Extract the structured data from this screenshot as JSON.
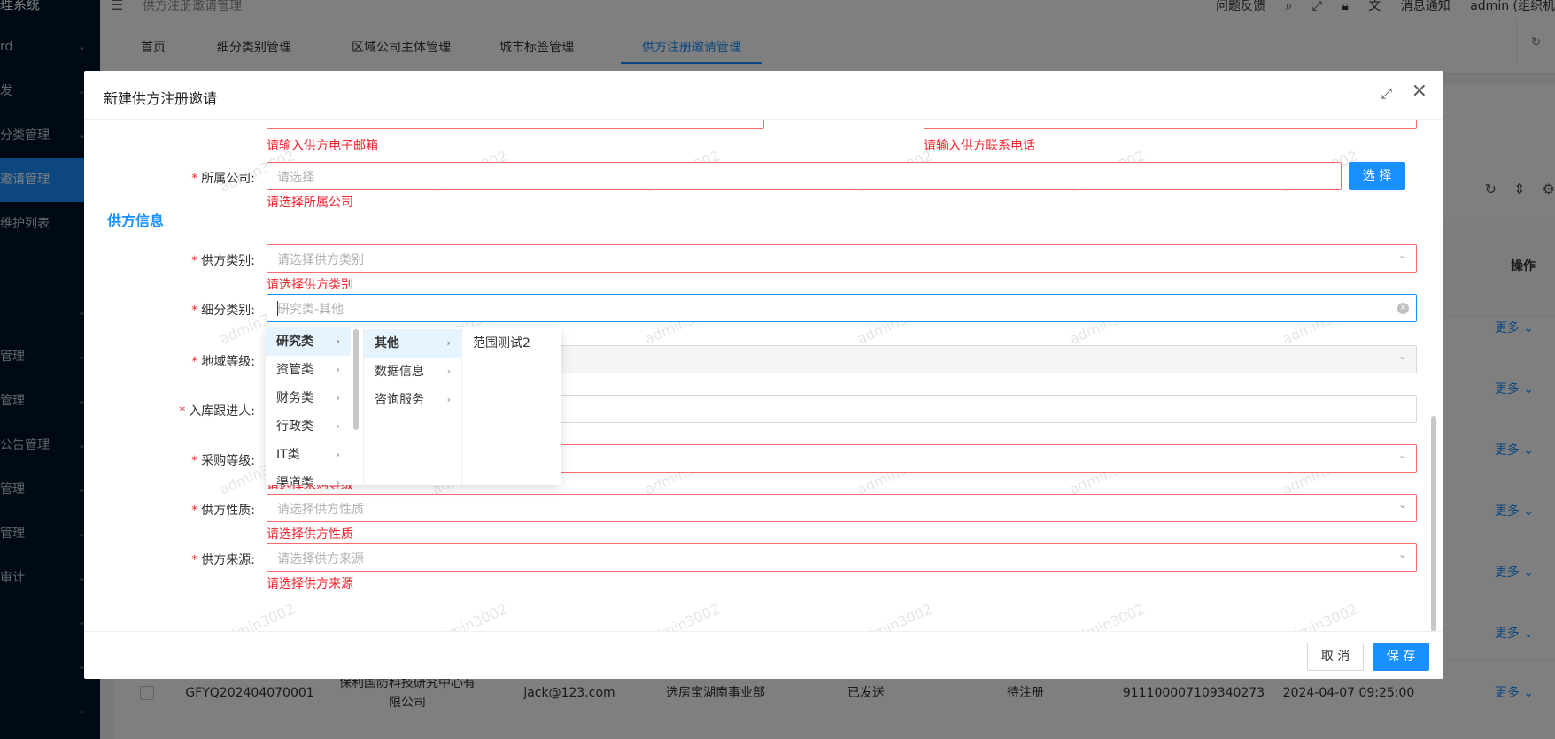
{
  "app": {
    "title": "理系统",
    "breadcrumb": "供方注册邀请管理",
    "toolbar": {
      "feedback": "问题反馈",
      "notifications": "消息通知",
      "user": "admin (组织机"
    }
  },
  "sidebar": {
    "items": [
      {
        "label": "rd"
      },
      {
        "label": "发"
      },
      {
        "label": "分类管理"
      },
      {
        "label": "邀请管理"
      },
      {
        "label": "维护列表"
      },
      {
        "label": ""
      },
      {
        "label": "管理"
      },
      {
        "label": "管理"
      },
      {
        "label": "公告管理"
      },
      {
        "label": "管理"
      },
      {
        "label": "管理"
      },
      {
        "label": "审计"
      },
      {
        "label": ""
      },
      {
        "label": ""
      },
      {
        "label": ""
      }
    ]
  },
  "tabs": [
    {
      "label": "首页"
    },
    {
      "label": "细分类别管理"
    },
    {
      "label": "区域公司主体管理"
    },
    {
      "label": "城市标签管理"
    },
    {
      "label": "供方注册邀请管理"
    }
  ],
  "table": {
    "op_header": "操作",
    "more_label": "更多",
    "row": {
      "code": "GFYQ202404070001",
      "company": "保利国防科技研究中心有限公司",
      "email": "jack@123.com",
      "dept": "选房宝湖南事业部",
      "send_status": "已发送",
      "reg_status": "待注册",
      "credit_code": "911100007109340273",
      "time": "2024-04-07 09:25:00"
    }
  },
  "dialog": {
    "title": "新建供方注册邀请",
    "watermark": "admin3002",
    "errors": {
      "email": "请输入供方电子邮箱",
      "phone": "请输入供方联系电话",
      "company": "请选择所属公司",
      "supplier_category": "请选择供方类别",
      "purchase_level_partial": "请选择采购等级",
      "nature": "请选择供方性质",
      "source": "请选择供方来源"
    },
    "fields": {
      "company": {
        "label": "所属公司:",
        "placeholder": "请选择",
        "button": "选 择"
      },
      "section_title": "供方信息",
      "supplier_category": {
        "label": "供方类别:",
        "placeholder": "请选择供方类别"
      },
      "sub_category": {
        "label": "细分类别:",
        "placeholder": "研究类-其他"
      },
      "region_level": {
        "label": "地域等级:"
      },
      "follower": {
        "label": "入库跟进人:"
      },
      "purchase_level": {
        "label": "采购等级:"
      },
      "nature": {
        "label": "供方性质:",
        "placeholder": "请选择供方性质"
      },
      "source": {
        "label": "供方来源:",
        "placeholder": "请选择供方来源"
      }
    },
    "cascader": {
      "col1": [
        "研究类",
        "资管类",
        "财务类",
        "行政类",
        "IT类",
        "渠道类"
      ],
      "col2": [
        "其他",
        "数据信息",
        "咨询服务"
      ],
      "col3": [
        "范围测试2"
      ]
    },
    "footer": {
      "cancel": "取 消",
      "save": "保 存"
    }
  }
}
